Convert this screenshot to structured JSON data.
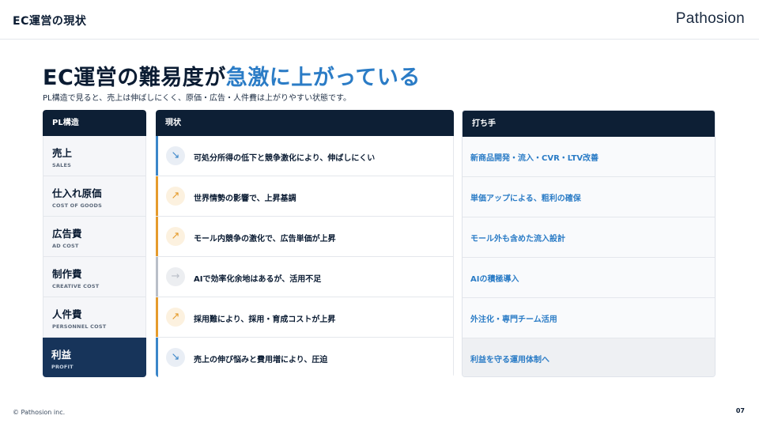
{
  "header": {
    "section_label": "EC運営の現状",
    "brand": "Pathosion"
  },
  "title": {
    "main": "EC運営の難易度が",
    "accent": "急激に上がっている"
  },
  "subtitle": "PL構造で見ると、売上は伸ばしにくく、原価・広告・人件費は上がりやすい状態です。",
  "columns": {
    "pl": "PL構造",
    "status": "現状",
    "action": "打ち手"
  },
  "rows": [
    {
      "pl_jp": "売上",
      "pl_en": "SALES",
      "trend": "down",
      "arrow": "↘",
      "status": "可処分所得の低下と競争激化により、伸ばしにくい",
      "action": "新商品開発・流入・CVR・LTV改善"
    },
    {
      "pl_jp": "仕入れ原価",
      "pl_en": "COST OF GOODS",
      "trend": "up",
      "arrow": "↗",
      "status": "世界情勢の影響で、上昇基調",
      "action": "単価アップによる、粗利の確保"
    },
    {
      "pl_jp": "広告費",
      "pl_en": "AD COST",
      "trend": "up",
      "arrow": "↗",
      "status": "モール内競争の激化で、広告単価が上昇",
      "action": "モール外も含めた流入設計"
    },
    {
      "pl_jp": "制作費",
      "pl_en": "CREATIVE COST",
      "trend": "flat",
      "arrow": "→",
      "status": "AIで効率化余地はあるが、活用不足",
      "action": "AIの積極導入"
    },
    {
      "pl_jp": "人件費",
      "pl_en": "PERSONNEL COST",
      "trend": "up",
      "arrow": "↗",
      "status": "採用難により、採用・育成コストが上昇",
      "action": "外注化・専門チーム活用"
    },
    {
      "pl_jp": "利益",
      "pl_en": "PROFIT",
      "trend": "down",
      "arrow": "↘",
      "status": "売上の伸び悩みと費用増により、圧迫",
      "action": "利益を守る運用体制へ"
    }
  ],
  "colors": {
    "navy": "#0d1f35",
    "accent_blue": "#2b7cc6",
    "up": "#e59b2c",
    "up_bg": "#fcf1df",
    "down": "#3b86c9",
    "down_bg": "#e9eef5",
    "flat": "#b9bfc8",
    "flat_bg": "#eceef1"
  },
  "footer": {
    "copyright": "© Pathosion inc.",
    "page_number": "07"
  }
}
